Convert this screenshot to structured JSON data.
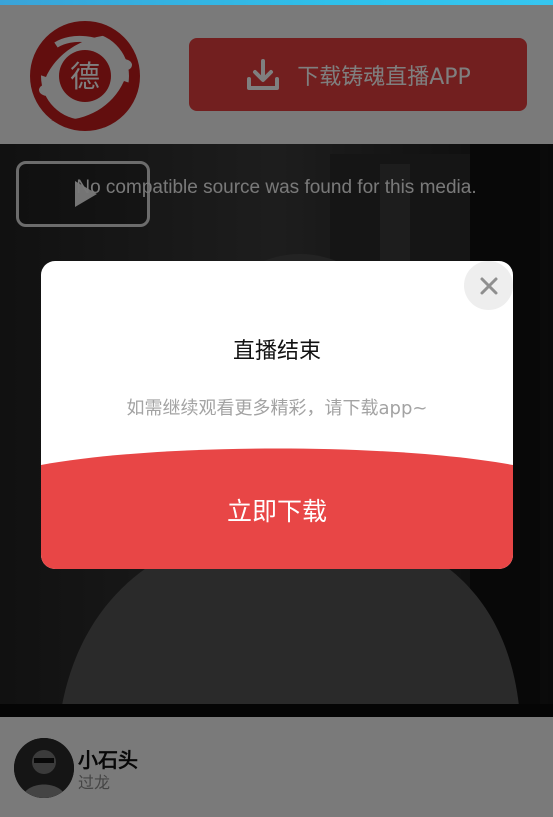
{
  "header": {
    "logo_char": "德",
    "download_button_label": "下载铸魂直播APP",
    "download_icon": "download-icon",
    "accent_color": "#e53e3e"
  },
  "video": {
    "error_message": "No compatible source was found for this media.",
    "play_icon": "play-icon"
  },
  "streamer": {
    "name": "小石头",
    "subtitle": "过龙"
  },
  "modal": {
    "title": "直播结束",
    "message": "如需继续观看更多精彩，请下载app~",
    "cta_label": "立即下载",
    "close_icon": "close-icon",
    "cta_color": "#e84646"
  }
}
